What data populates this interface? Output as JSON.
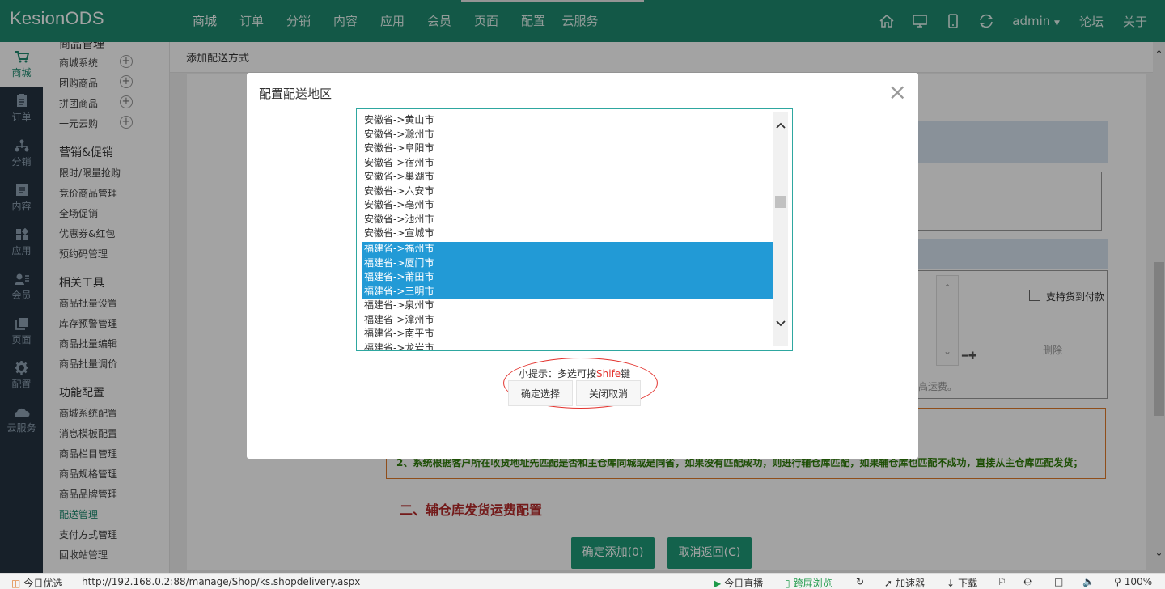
{
  "brand": "KesionODS",
  "topnav": [
    "商城",
    "订单",
    "分销",
    "内容",
    "应用",
    "会员",
    "页面",
    "配置",
    "云服务"
  ],
  "topright": {
    "user": "admin",
    "forum": "论坛",
    "about": "关于"
  },
  "rail": [
    "商城",
    "订单",
    "分销",
    "内容",
    "应用",
    "会员",
    "页面",
    "配置",
    "云服务"
  ],
  "sidebar": {
    "group1": "商品管理",
    "group1_items": [
      "商城系统",
      "团购商品",
      "拼团商品",
      "一元云购"
    ],
    "group2": "营销&促销",
    "group2_items": [
      "限时/限量抢购",
      "竞价商品管理",
      "全场促销",
      "优惠券&红包",
      "预约码管理"
    ],
    "group3": "相关工具",
    "group3_items": [
      "商品批量设置",
      "库存预警管理",
      "商品批量编辑",
      "商品批量调价"
    ],
    "group4": "功能配置",
    "group4_items": [
      "商城系统配置",
      "消息模板配置",
      "商品栏目管理",
      "商品规格管理",
      "商品品牌管理",
      "配送管理",
      "支付方式管理",
      "回收站管理"
    ]
  },
  "breadcrumb": "添加配送方式",
  "background": {
    "cod_label": "支持货到付款",
    "delete_label": "删除",
    "freight_note": "高运费。",
    "warning_line": "2、系统根据客户所在收货地址先匹配是否和主仓库同城或是同省，如果没有匹配成功，则进行辅仓库匹配，如果辅仓库也匹配不成功，直接从主仓库匹配发货；",
    "section_title": "二、辅仓库发货运费配置",
    "confirm_add": "确定添加(0)",
    "cancel_back": "取消返回(C)"
  },
  "modal": {
    "title": "配置配送地区",
    "regions": [
      "安徽省->黄山市",
      "安徽省->滁州市",
      "安徽省->阜阳市",
      "安徽省->宿州市",
      "安徽省->巢湖市",
      "安徽省->六安市",
      "安徽省->亳州市",
      "安徽省->池州市",
      "安徽省->宣城市",
      "福建省->福州市",
      "福建省->厦门市",
      "福建省->莆田市",
      "福建省->三明市",
      "福建省->泉州市",
      "福建省->漳州市",
      "福建省->南平市",
      "福建省->龙岩市"
    ],
    "selected": [
      "福建省->福州市",
      "福建省->厦门市",
      "福建省->莆田市",
      "福建省->三明市"
    ],
    "tip_prefix": "小提示：多选可按",
    "tip_key": "Shife",
    "tip_suffix": "键",
    "confirm": "确定选择",
    "cancel": "关闭取消"
  },
  "statusbar": {
    "left": "今日优选",
    "url": "http://192.168.0.2:88/manage/Shop/ks.shopdelivery.aspx",
    "live": "今日直播",
    "cross_screen": "跨屏浏览",
    "accelerator": "加速器",
    "download": "下载",
    "zoom": "100%"
  },
  "colors": {
    "topbar": "#1e8a6f",
    "rail": "#243240",
    "selection": "#229ad6",
    "accent_red": "#e3342f"
  }
}
